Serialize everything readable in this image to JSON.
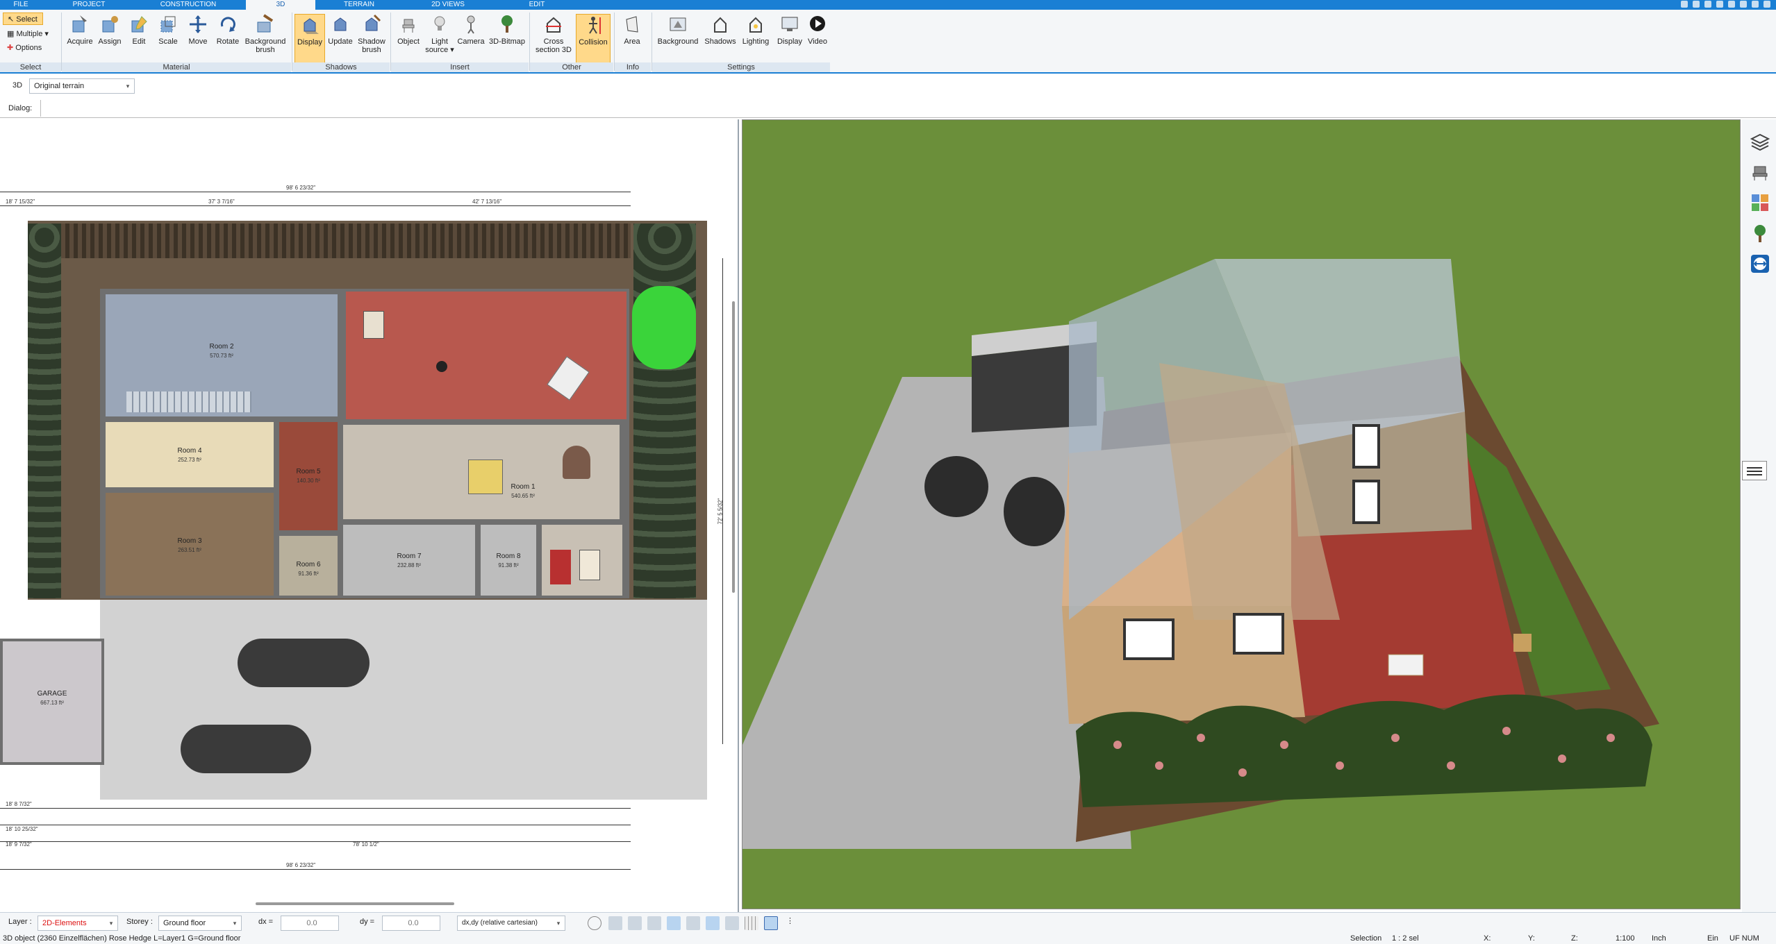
{
  "menu": {
    "tabs": [
      {
        "label": "FILE"
      },
      {
        "label": "PROJECT"
      },
      {
        "label": "CONSTRUCTION"
      },
      {
        "label": "3D",
        "active": true
      },
      {
        "label": "TERRAIN"
      },
      {
        "label": "2D VIEWS"
      },
      {
        "label": "EDIT"
      }
    ]
  },
  "ribbon": {
    "select": {
      "label": "Select",
      "multiple": "Multiple",
      "options": "Options",
      "group": "Select"
    },
    "material": {
      "group": "Material",
      "buttons": [
        {
          "label": "Acquire",
          "icon": "acquire-icon"
        },
        {
          "label": "Assign",
          "icon": "assign-icon"
        },
        {
          "label": "Edit",
          "icon": "edit-icon"
        },
        {
          "label": "Scale",
          "icon": "scale-icon"
        },
        {
          "label": "Move",
          "icon": "move-icon"
        },
        {
          "label": "Rotate",
          "icon": "rotate-icon"
        },
        {
          "label": "Background brush",
          "icon": "background-brush-icon"
        }
      ]
    },
    "shadows": {
      "group": "Shadows",
      "buttons": [
        {
          "label": "Display",
          "icon": "shadow-display-icon",
          "active": true
        },
        {
          "label": "Update",
          "icon": "shadow-update-icon"
        },
        {
          "label": "Shadow brush",
          "icon": "shadow-brush-icon"
        }
      ]
    },
    "insert": {
      "group": "Insert",
      "buttons": [
        {
          "label": "Object",
          "icon": "object-icon"
        },
        {
          "label": "Light source",
          "icon": "light-source-icon"
        },
        {
          "label": "Camera",
          "icon": "camera-icon"
        },
        {
          "label": "3D-Bitmap",
          "icon": "tree-bitmap-icon"
        }
      ]
    },
    "other": {
      "group": "Other",
      "buttons": [
        {
          "label": "Cross section 3D",
          "icon": "cross-section-icon"
        },
        {
          "label": "Collision",
          "icon": "collision-icon",
          "active": true
        }
      ]
    },
    "info": {
      "group": "Info",
      "buttons": [
        {
          "label": "Area",
          "icon": "area-icon"
        }
      ]
    },
    "settings": {
      "group": "Settings",
      "buttons": [
        {
          "label": "Background",
          "icon": "background-icon"
        },
        {
          "label": "Shadows",
          "icon": "shadows-settings-icon"
        },
        {
          "label": "Lighting",
          "icon": "lighting-icon"
        },
        {
          "label": "Display",
          "icon": "display-settings-icon"
        },
        {
          "label": "Video",
          "icon": "video-icon"
        }
      ]
    }
  },
  "subtoolbar": {
    "mode": "3D",
    "terrain_select": "Original terrain",
    "dialog_label": "Dialog:"
  },
  "plan": {
    "rooms": [
      {
        "name": "Room 2",
        "area": "570.73 ft²"
      },
      {
        "name": "Room 4",
        "area": "252.73 ft²"
      },
      {
        "name": "Room 5",
        "area": "140.30 ft²"
      },
      {
        "name": "Room 1",
        "area": "540.65 ft²"
      },
      {
        "name": "Room 3",
        "area": "263.51 ft²"
      },
      {
        "name": "Room 6",
        "area": "91.36 ft²"
      },
      {
        "name": "Room 7",
        "area": "232.88 ft²"
      },
      {
        "name": "Room 8",
        "area": "91.38 ft²"
      },
      {
        "name": "GARAGE",
        "area": "667.13 ft²"
      }
    ],
    "dims": {
      "top_total": "98' 6 23/32\"",
      "top_left": "18' 7 15/32\"",
      "top_mid": "37' 3 7/16\"",
      "top_right": "42' 7 13/16\"",
      "bottom_total": "98' 6 23/32\"",
      "bottom_mid": "78' 10 1/2\"",
      "bottom_left1": "18' 8 7/32\"",
      "bottom_left2": "18' 10 25/32\"",
      "bottom_left3": "18' 9 7/32\"",
      "right_side": "72' 5 5/32\""
    }
  },
  "bottom": {
    "layer_label": "Layer :",
    "layer_value": "2D-Elements",
    "storey_label": "Storey :",
    "storey_value": "Ground floor",
    "dx_label": "dx =",
    "dx_value": "0.0",
    "dy_label": "dy =",
    "dy_value": "0.0",
    "coord_mode": "dx,dy (relative cartesian)"
  },
  "status": {
    "message": "3D object (2360 Einzelflächen) Rose Hedge L=Layer1 G=Ground floor",
    "selection": "Selection",
    "sel_count": "1 : 2 sel",
    "x": "X:",
    "y": "Y:",
    "z": "Z:",
    "scale": "1:100",
    "unit": "Inch",
    "ein": "Ein",
    "flags": "UF NUM"
  },
  "colors": {
    "accent": "#1a7fd4",
    "active_button": "#ffd98a",
    "grass": "#6b8f3a",
    "patio_red": "#b8584e",
    "room_blue": "#9aa6b8",
    "room_beige": "#e8dbb8",
    "floor_brown": "#8a7258"
  }
}
